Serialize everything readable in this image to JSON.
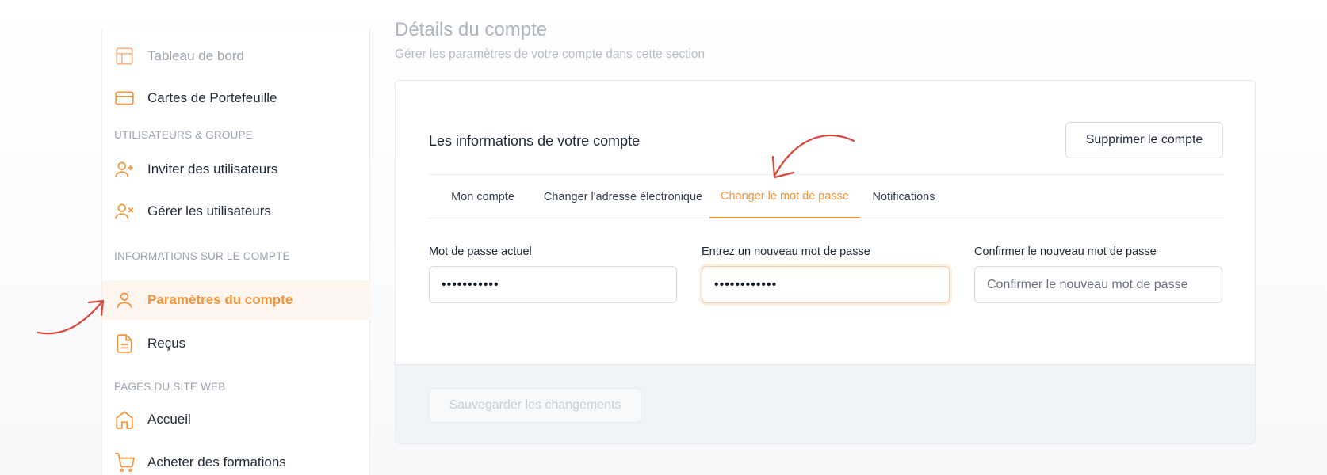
{
  "sidebar": {
    "items": [
      {
        "label": "Tableau de bord",
        "icon": "layout-icon"
      },
      {
        "label": "Cartes de Portefeuille",
        "icon": "credit-card-icon"
      },
      {
        "label": "Inviter des utilisateurs",
        "icon": "user-plus-icon"
      },
      {
        "label": "Gérer les utilisateurs",
        "icon": "user-x-icon"
      },
      {
        "label": "Paramètres du compte",
        "icon": "user-icon",
        "active": true
      },
      {
        "label": "Reçus",
        "icon": "file-text-icon"
      },
      {
        "label": "Accueil",
        "icon": "home-icon"
      },
      {
        "label": "Acheter des formations",
        "icon": "cart-icon"
      }
    ],
    "sections": [
      "UTILISATEURS & GROUPE",
      "INFORMATIONS SUR LE COMPTE",
      "PAGES DU SITE WEB"
    ]
  },
  "header": {
    "title": "Détails du compte",
    "subtitle": "Gérer les paramètres de votre compte dans cette section"
  },
  "card": {
    "title": "Les informations de votre compte",
    "delete_label": "Supprimer le compte",
    "tabs": [
      {
        "label": "Mon compte"
      },
      {
        "label": "Changer l'adresse électronique"
      },
      {
        "label": "Changer le mot de passe",
        "active": true
      },
      {
        "label": "Notifications"
      }
    ],
    "fields": [
      {
        "label": "Mot de passe actuel",
        "value": "•••••••••••",
        "placeholder": ""
      },
      {
        "label": "Entrez un nouveau mot de passe",
        "value": "••••••••••••",
        "placeholder": ""
      },
      {
        "label": "Confirmer le nouveau mot de passe",
        "value": "",
        "placeholder": "Confirmer le nouveau mot de passe"
      }
    ],
    "save_label": "Sauvegarder les changements"
  },
  "colors": {
    "accent": "#f2933a",
    "annotation": "#d9483b"
  }
}
